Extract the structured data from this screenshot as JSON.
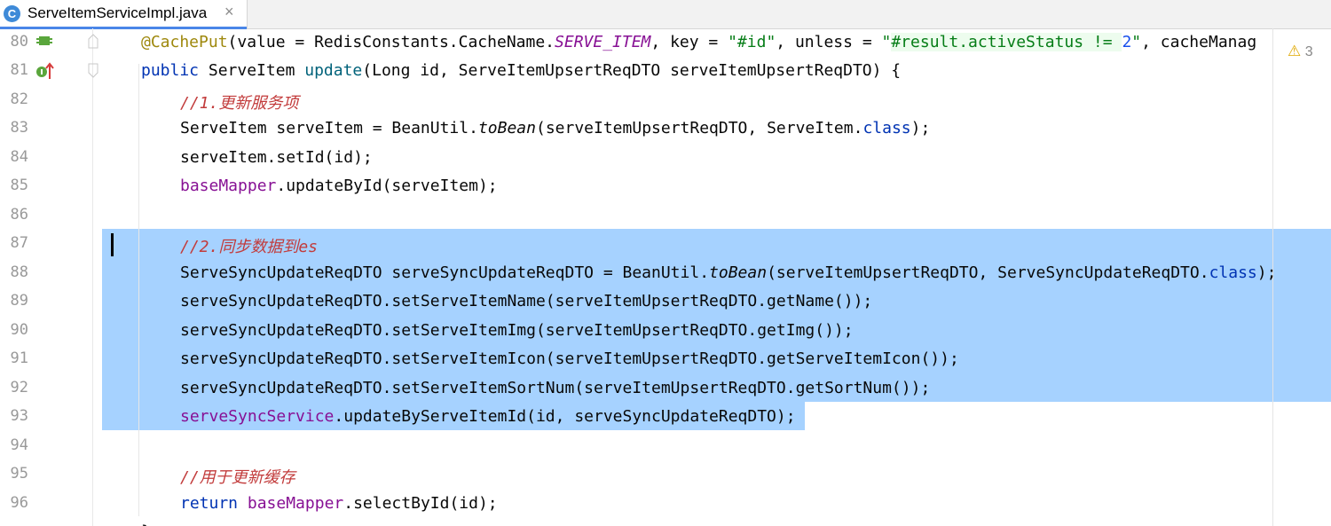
{
  "tab": {
    "icon_letter": "C",
    "label": "ServeItemServiceImpl.java",
    "close_glyph": "×"
  },
  "warnings": {
    "count": "3"
  },
  "line_numbers": [
    "80",
    "81",
    "82",
    "83",
    "84",
    "85",
    "86",
    "87",
    "88",
    "89",
    "90",
    "91",
    "92",
    "93",
    "94",
    "95",
    "96"
  ],
  "code": {
    "l80": {
      "annotation": "@CachePut",
      "t1": "(value = RedisConstants.CacheName.",
      "const": "SERVE_ITEM",
      "t2": ", key = ",
      "s1": "\"#id\"",
      "t3": ", unless = ",
      "s2a": "\"",
      "s2b": "#result.activeStatus != ",
      "s2num": "2",
      "s2c": "\"",
      "t4": ", cacheManag"
    },
    "l81": {
      "kw1": "public",
      "t1": " ServeItem ",
      "fn": "update",
      "t2": "(Long id, ServeItemUpsertReqDTO serveItemUpsertReqDTO) {"
    },
    "l82": {
      "comment": "//1.更新服务项"
    },
    "l83": {
      "t1": "ServeItem serveItem = BeanUtil.",
      "st": "toBean",
      "t2": "(serveItemUpsertReqDTO, ServeItem.",
      "kw": "class",
      "t3": ");"
    },
    "l84": {
      "t1": "serveItem.setId(id);"
    },
    "l85": {
      "fld": "baseMapper",
      "t1": ".updateById(serveItem);"
    },
    "l87": {
      "comment": "//2.同步数据到es"
    },
    "l88": {
      "t1": "ServeSyncUpdateReqDTO serveSyncUpdateReqDTO = BeanUtil.",
      "st": "toBean",
      "t2": "(serveItemUpsertReqDTO, ServeSyncUpdateReqDTO.",
      "kw": "class",
      "t3": ");"
    },
    "l89": {
      "t1": "serveSyncUpdateReqDTO.setServeItemName(serveItemUpsertReqDTO.getName());"
    },
    "l90": {
      "t1": "serveSyncUpdateReqDTO.setServeItemImg(serveItemUpsertReqDTO.getImg());"
    },
    "l91": {
      "t1": "serveSyncUpdateReqDTO.setServeItemIcon(serveItemUpsertReqDTO.getServeItemIcon());"
    },
    "l92": {
      "t1": "serveSyncUpdateReqDTO.setServeItemSortNum(serveItemUpsertReqDTO.getSortNum());"
    },
    "l93": {
      "fld": "serveSyncService",
      "t1": ".updateByServeItemId(id, serveSyncUpdateReqDTO);"
    },
    "l95": {
      "comment": "//用于更新缓存"
    },
    "l96": {
      "kw": "return",
      "t1": " ",
      "fld": "baseMapper",
      "t2": ".selectById(id);"
    },
    "l97": {
      "t1": "}"
    }
  },
  "colors": {
    "selection": "#a6d2ff",
    "keyword": "#0033b3",
    "string": "#067d17",
    "comment": "#c23b3b",
    "field": "#871094",
    "annotation": "#9e880d",
    "tab_accent": "#4a86e8"
  }
}
